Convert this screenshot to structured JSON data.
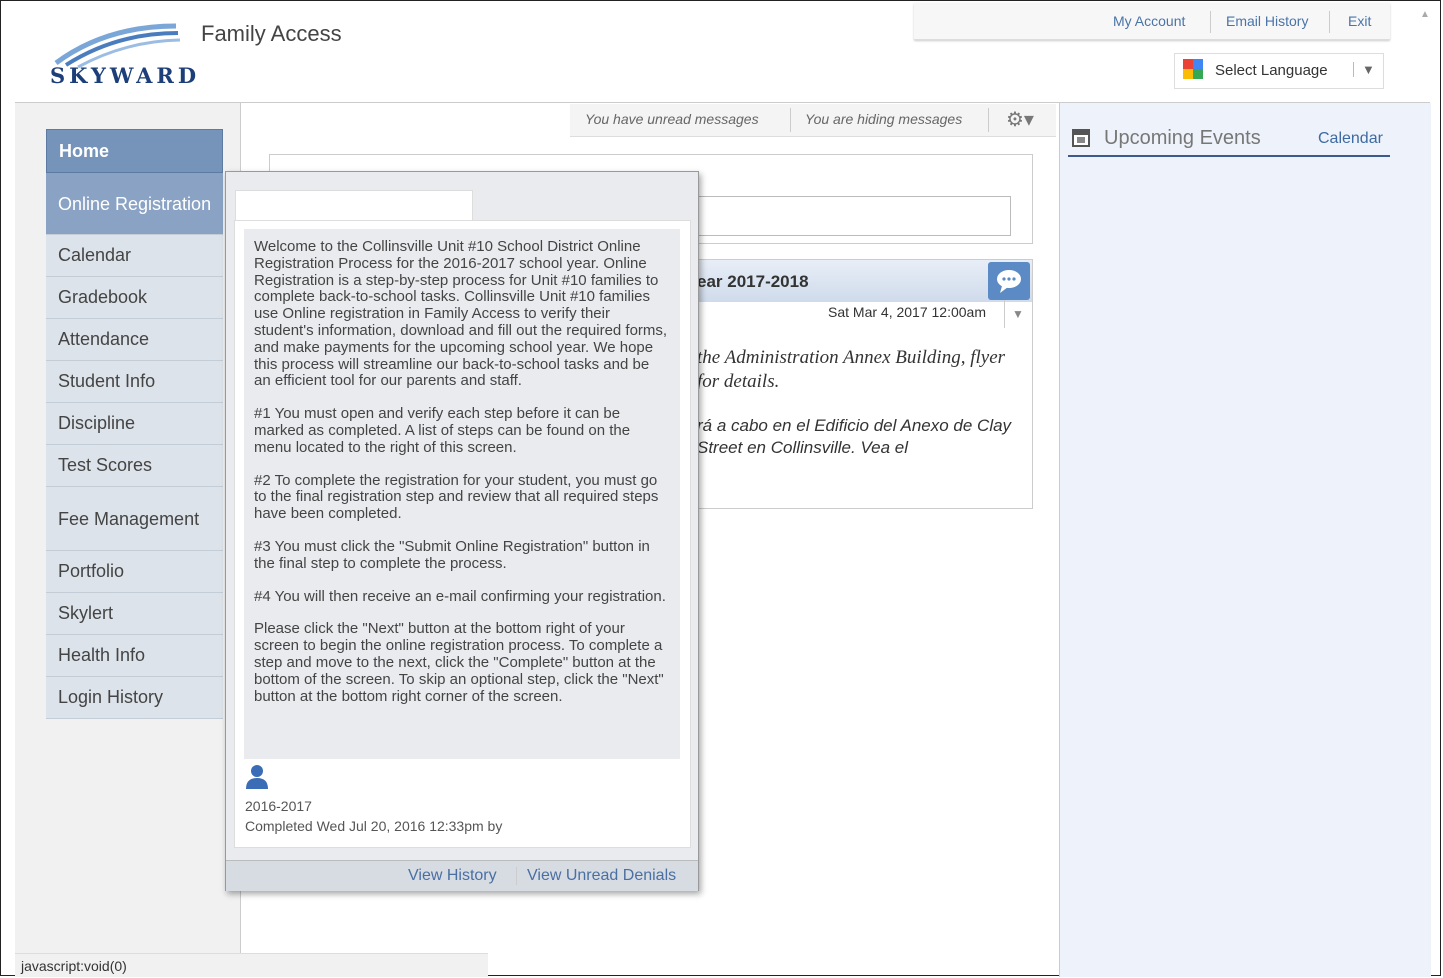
{
  "header": {
    "logo_text": "SKYWARD",
    "app_title": "Family Access",
    "links": [
      "My Account",
      "Email History",
      "Exit"
    ],
    "language_select": "Select Language"
  },
  "nav": {
    "items": [
      {
        "label": "Home",
        "state": "home"
      },
      {
        "label": "Online Registration",
        "state": "selected"
      },
      {
        "label": "Calendar",
        "state": "normal"
      },
      {
        "label": "Gradebook",
        "state": "normal"
      },
      {
        "label": "Attendance",
        "state": "normal"
      },
      {
        "label": "Student Info",
        "state": "normal"
      },
      {
        "label": "Discipline",
        "state": "normal"
      },
      {
        "label": "Test Scores",
        "state": "normal"
      },
      {
        "label": "Fee Management",
        "state": "tall"
      },
      {
        "label": "Portfolio",
        "state": "normal"
      },
      {
        "label": "Skylert",
        "state": "normal"
      },
      {
        "label": "Health Info",
        "state": "normal"
      },
      {
        "label": "Login History",
        "state": "normal"
      }
    ]
  },
  "messages_bar": {
    "unread": "You have unread messages",
    "hiding": "You are hiding messages"
  },
  "message_card": {
    "title": "ear 2017-2018",
    "date": "Sat Mar 4, 2017 12:00am",
    "body_en": "the Administration Annex Building, flyer for details.",
    "body_es": "rá a cabo en el Edificio del Anexo de Clay Street en Collinsville.  Vea el"
  },
  "events": {
    "title": "Upcoming Events",
    "calendar_link": "Calendar"
  },
  "popup": {
    "paragraphs": [
      "Welcome to the Collinsville Unit #10 School District Online Registration Process for the 2016-2017 school year. Online Registration is a step-by-step process for Unit #10 families to complete back-to-school tasks. Collinsville Unit #10 families use Online registration in Family Access to verify their student's information, download and fill out the required forms, and make payments for the upcoming school year. We hope this process will streamline our back-to-school tasks and be an efficient tool for our parents and staff.",
      "#1 You must open and verify each step before it can be marked as completed. A list of steps can be found on the menu located to the right of this screen.",
      "#2 To complete the registration for your student, you must go to the final registration step and review that all required steps have been completed.",
      "#3 You must click the \"Submit Online Registration\" button in the final step to complete the process.",
      "#4 You will then receive an e-mail confirming your registration.",
      "Please click the \"Next\" button at the bottom right of your screen to begin the online registration process. To complete a step and move to the next, click the \"Complete\" button at the bottom of the screen. To skip an optional step, click the \"Next\" button at the bottom right corner of the screen."
    ],
    "year": "2016-2017",
    "completed": "Completed Wed Jul 20, 2016 12:33pm by",
    "footer": {
      "view_history": "View History",
      "view_unread_denials": "View Unread Denials"
    }
  },
  "status_bar": "javascript:void(0)",
  "colors": {
    "nav_home": "#7694ba",
    "nav_selected": "#8aa3c4",
    "link": "#4a74a8"
  }
}
